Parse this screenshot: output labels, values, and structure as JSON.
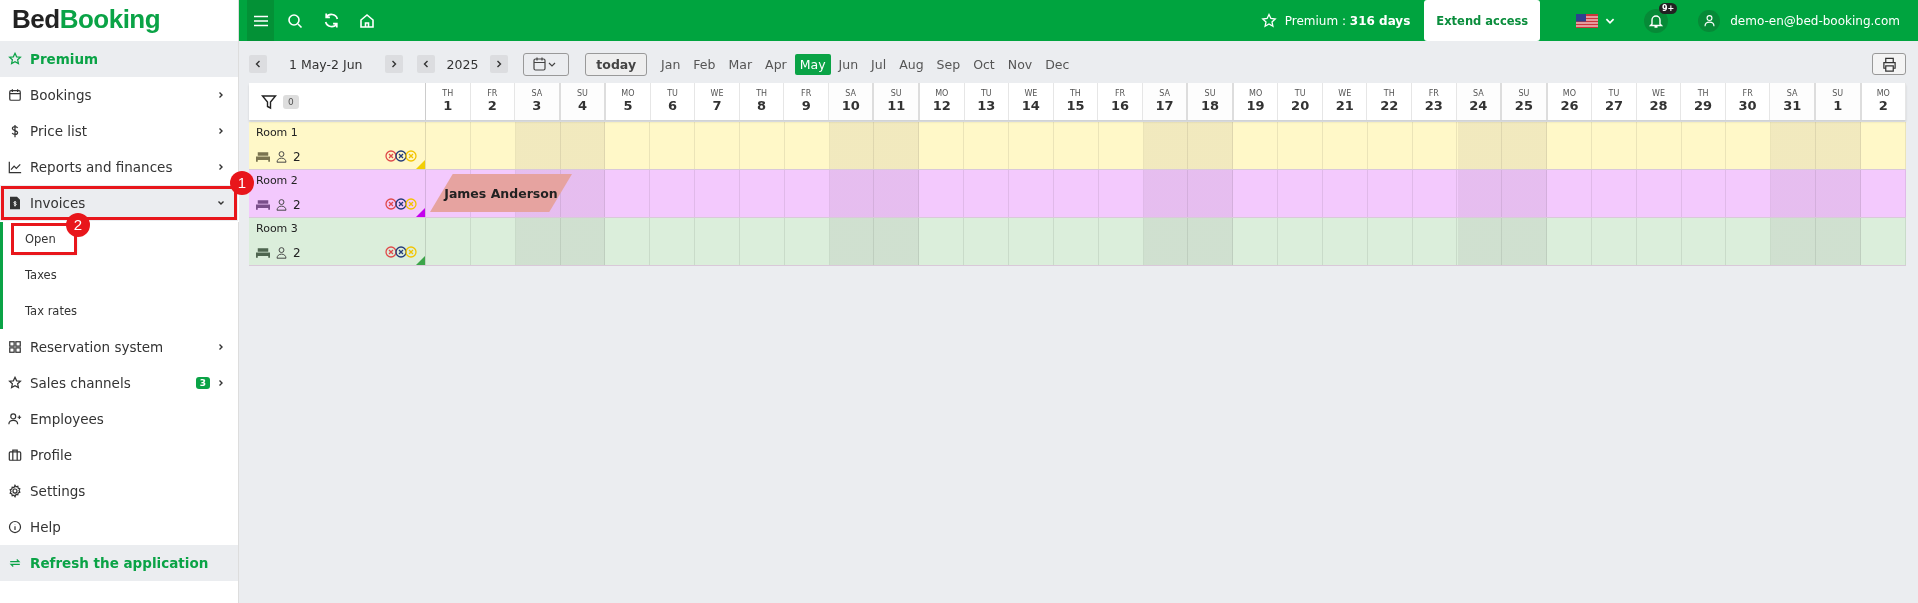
{
  "logo": {
    "part_1": "Bed",
    "part_2": "Booking"
  },
  "sidebar": {
    "items": [
      {
        "kind": "highlight",
        "label": "Premium"
      },
      {
        "kind": "item",
        "label": "Bookings",
        "chevron": true
      },
      {
        "kind": "item",
        "label": "Price list",
        "chevron": true
      },
      {
        "kind": "item",
        "label": "Reports and finances",
        "chevron": true
      },
      {
        "kind": "item",
        "label": "Invoices",
        "chevron": true,
        "expanded": true,
        "callout": "1",
        "children": [
          {
            "label": "Open",
            "callout": "2"
          },
          {
            "label": "Taxes"
          },
          {
            "label": "Tax rates"
          }
        ]
      },
      {
        "kind": "item",
        "label": "Reservation system",
        "chevron": true
      },
      {
        "kind": "item",
        "label": "Sales channels",
        "chevron": true,
        "badge": "3"
      },
      {
        "kind": "item",
        "label": "Employees"
      },
      {
        "kind": "item",
        "label": "Profile"
      },
      {
        "kind": "item",
        "label": "Settings"
      },
      {
        "kind": "item",
        "label": "Help"
      },
      {
        "kind": "highlight",
        "label": "Refresh the application"
      }
    ]
  },
  "topbar": {
    "premium": "Premium : **316 days**",
    "extend_button": "Extend access",
    "notifications_badge": "9+",
    "user": "demo-en@bed-booking.com"
  },
  "toolbar": {
    "range": "1 May-2 Jun",
    "year": "2025",
    "today_button": "today",
    "months": [
      {
        "label": "Jan",
        "selected": false
      },
      {
        "label": "Feb",
        "selected": false
      },
      {
        "label": "Mar",
        "selected": false
      },
      {
        "label": "Apr",
        "selected": false
      },
      {
        "label": "May",
        "selected": true
      },
      {
        "label": "Jun",
        "selected": false
      },
      {
        "label": "Jul",
        "selected": false
      },
      {
        "label": "Aug",
        "selected": false
      },
      {
        "label": "Sep",
        "selected": false
      },
      {
        "label": "Oct",
        "selected": false
      },
      {
        "label": "Nov",
        "selected": false
      },
      {
        "label": "Dec",
        "selected": false
      }
    ]
  },
  "calendar": {
    "filter_count": "0",
    "days": [
      {
        "weekday": "TH",
        "day": "1",
        "weekend": false
      },
      {
        "weekday": "FR",
        "day": "2",
        "weekend": false
      },
      {
        "weekday": "SA",
        "day": "3",
        "weekend": true
      },
      {
        "weekday": "SU",
        "day": "4",
        "weekend": true
      },
      {
        "weekday": "MO",
        "day": "5",
        "weekend": false
      },
      {
        "weekday": "TU",
        "day": "6",
        "weekend": false
      },
      {
        "weekday": "WE",
        "day": "7",
        "weekend": false
      },
      {
        "weekday": "TH",
        "day": "8",
        "weekend": false
      },
      {
        "weekday": "FR",
        "day": "9",
        "weekend": false
      },
      {
        "weekday": "SA",
        "day": "10",
        "weekend": true
      },
      {
        "weekday": "SU",
        "day": "11",
        "weekend": true
      },
      {
        "weekday": "MO",
        "day": "12",
        "weekend": false
      },
      {
        "weekday": "TU",
        "day": "13",
        "weekend": false
      },
      {
        "weekday": "WE",
        "day": "14",
        "weekend": false
      },
      {
        "weekday": "TH",
        "day": "15",
        "weekend": false
      },
      {
        "weekday": "FR",
        "day": "16",
        "weekend": false
      },
      {
        "weekday": "SA",
        "day": "17",
        "weekend": true
      },
      {
        "weekday": "SU",
        "day": "18",
        "weekend": true
      },
      {
        "weekday": "MO",
        "day": "19",
        "weekend": false
      },
      {
        "weekday": "TU",
        "day": "20",
        "weekend": false
      },
      {
        "weekday": "WE",
        "day": "21",
        "weekend": false
      },
      {
        "weekday": "TH",
        "day": "22",
        "weekend": false
      },
      {
        "weekday": "FR",
        "day": "23",
        "weekend": false
      },
      {
        "weekday": "SA",
        "day": "24",
        "weekend": true
      },
      {
        "weekday": "SU",
        "day": "25",
        "weekend": true
      },
      {
        "weekday": "MO",
        "day": "26",
        "weekend": false
      },
      {
        "weekday": "TU",
        "day": "27",
        "weekend": false
      },
      {
        "weekday": "WE",
        "day": "28",
        "weekend": false
      },
      {
        "weekday": "TH",
        "day": "29",
        "weekend": false
      },
      {
        "weekday": "FR",
        "day": "30",
        "weekend": false
      },
      {
        "weekday": "SA",
        "day": "31",
        "weekend": true
      },
      {
        "weekday": "SU",
        "day": "1",
        "weekend": true
      },
      {
        "weekday": "MO",
        "day": "2",
        "weekend": false
      }
    ],
    "rooms": [
      {
        "name": "Room 1",
        "guests": "2",
        "color": "#fff8c8"
      },
      {
        "name": "Room 2",
        "guests": "2",
        "color": "#f3c9fd",
        "booking": {
          "guest": "James Anderson"
        }
      },
      {
        "name": "Room 3",
        "guests": "2",
        "color": "#dbeedb"
      }
    ]
  }
}
